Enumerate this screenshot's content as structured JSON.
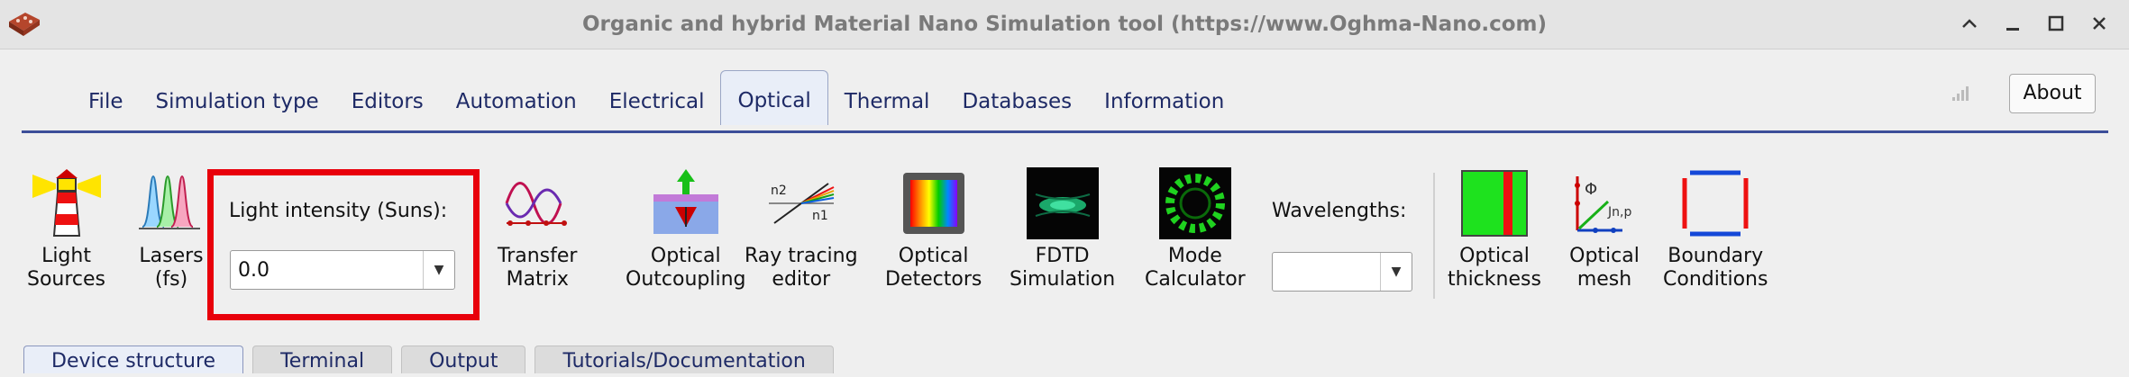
{
  "window": {
    "title": "Organic and hybrid Material Nano Simulation tool (https://www.Oghma-Nano.com)"
  },
  "menu": {
    "tabs": [
      {
        "label": "File"
      },
      {
        "label": "Simulation type"
      },
      {
        "label": "Editors"
      },
      {
        "label": "Automation"
      },
      {
        "label": "Electrical"
      },
      {
        "label": "Optical"
      },
      {
        "label": "Thermal"
      },
      {
        "label": "Databases"
      },
      {
        "label": "Information"
      }
    ],
    "active_tab": "Optical",
    "about_label": "About"
  },
  "toolbar": {
    "light_sources": "Light\nSources",
    "lasers": "Lasers\n(fs)",
    "light_intensity_label": "Light intensity (Suns):",
    "light_intensity_value": "0.0",
    "transfer_matrix": "Transfer\nMatrix",
    "optical_outcoupling": "Optical\nOutcoupling",
    "ray_tracing": "Ray tracing\neditor",
    "optical_detectors": "Optical\nDetectors",
    "fdtd": "FDTD\nSimulation",
    "mode_calculator": "Mode\nCalculator",
    "wavelengths_label": "Wavelengths:",
    "wavelengths_value": "",
    "optical_thickness": "Optical\nthickness",
    "optical_mesh": "Optical\nmesh",
    "boundary_conditions": "Boundary\nConditions",
    "ray_icon_n1": "n1",
    "ray_icon_n2": "n2",
    "mesh_icon_phi": "Φ",
    "mesh_icon_j": "Jn,p"
  },
  "bottom_tabs": [
    {
      "label": "Device structure"
    },
    {
      "label": "Terminal"
    },
    {
      "label": "Output"
    },
    {
      "label": "Tutorials/Documentation"
    }
  ],
  "colors": {
    "highlight": "#e8000b",
    "tab_text": "#1e2a66",
    "tab_underline": "#3c4e99"
  }
}
